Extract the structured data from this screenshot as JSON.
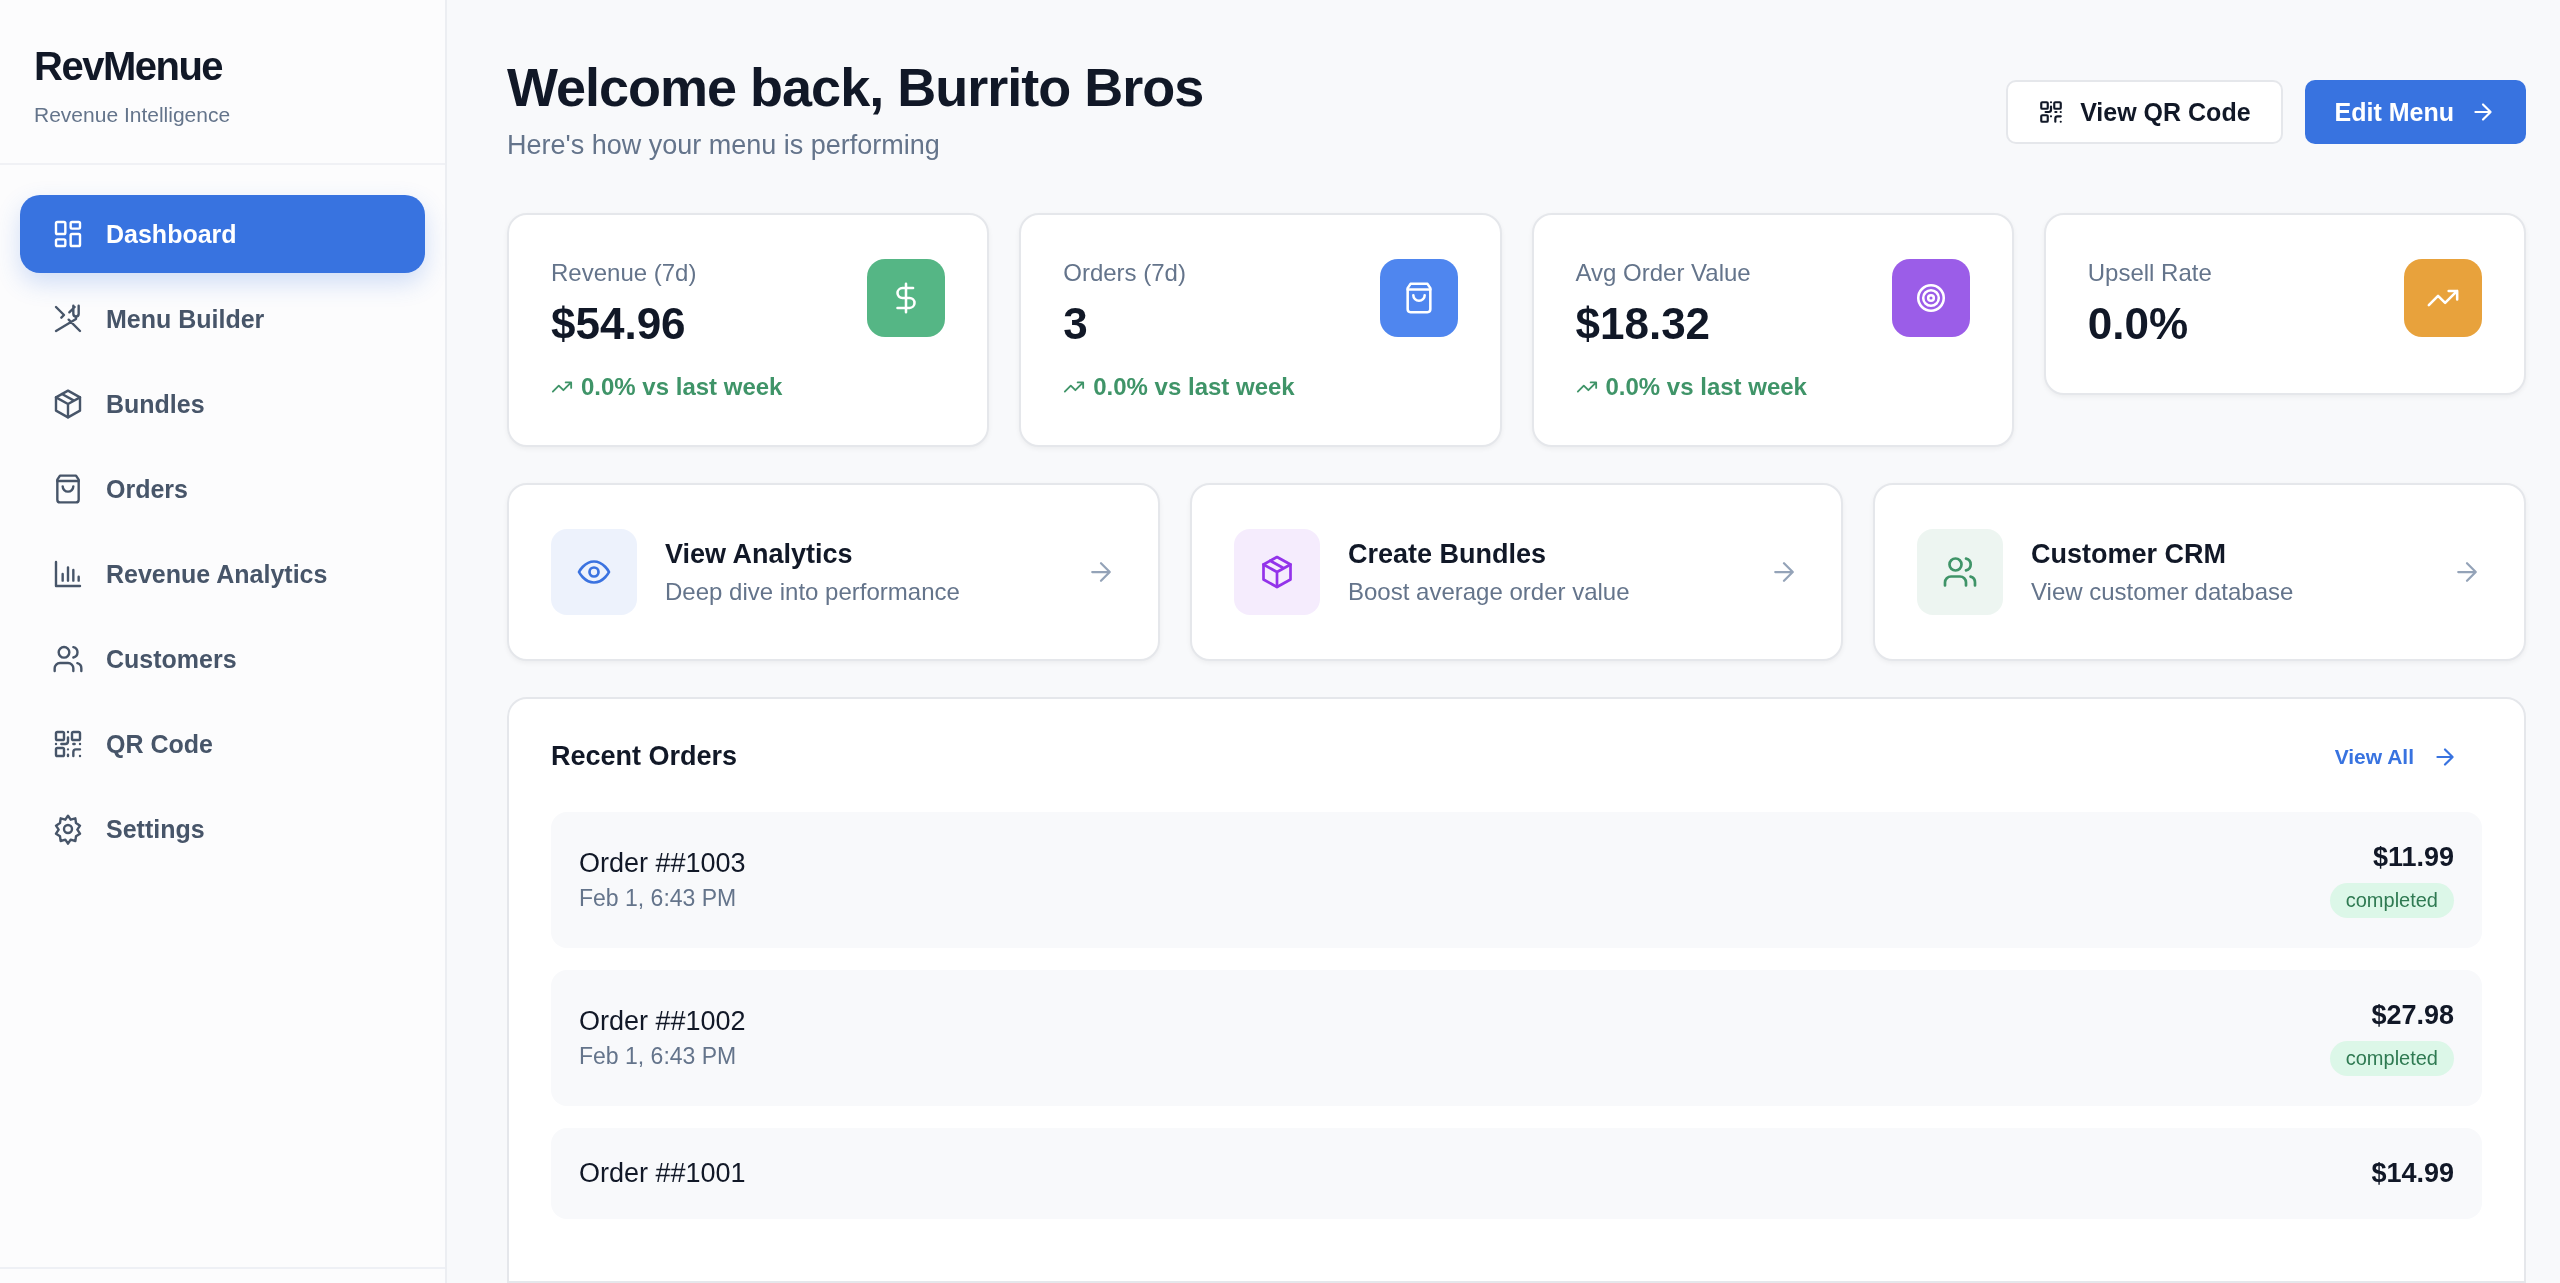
{
  "sidebar": {
    "logo": "RevMenue",
    "tagline": "Revenue Intelligence",
    "items": [
      {
        "label": "Dashboard",
        "selected": true
      },
      {
        "label": "Menu Builder",
        "selected": false
      },
      {
        "label": "Bundles",
        "selected": false
      },
      {
        "label": "Orders",
        "selected": false
      },
      {
        "label": "Revenue Analytics",
        "selected": false
      },
      {
        "label": "Customers",
        "selected": false
      },
      {
        "label": "QR Code",
        "selected": false
      },
      {
        "label": "Settings",
        "selected": false
      }
    ]
  },
  "header": {
    "title": "Welcome back, Burrito Bros",
    "subtitle": "Here's how your menu is performing",
    "buttons": [
      {
        "label": "View QR Code",
        "kind": "secondary"
      },
      {
        "label": "Edit Menu",
        "kind": "primary"
      }
    ]
  },
  "stats": [
    {
      "label": "Revenue (7d)",
      "value": "$54.96",
      "trend": "0.0% vs last week",
      "color": "#55b685"
    },
    {
      "label": "Orders (7d)",
      "value": "3",
      "trend": "0.0% vs last week",
      "color": "#4f86ef"
    },
    {
      "label": "Avg Order Value",
      "value": "$18.32",
      "trend": "0.0% vs last week",
      "color": "#9b5de8"
    },
    {
      "label": "Upsell Rate",
      "value": "0.0%",
      "color": "#e8a23c"
    }
  ],
  "actions": [
    {
      "title": "View Analytics",
      "description": "Deep dive into performance",
      "color": "#3b73e0"
    },
    {
      "title": "Create Bundles",
      "description": "Boost average order value",
      "color": "#9333ea"
    },
    {
      "title": "Customer CRM",
      "description": "View customer database",
      "color": "#3f9468"
    }
  ],
  "recent_orders": {
    "title": "Recent Orders",
    "link": "View All",
    "orders": [
      {
        "name": "Order ##1003",
        "time": "Feb 1, 6:43 PM",
        "total": "$11.99",
        "status": "completed"
      },
      {
        "name": "Order ##1002",
        "time": "Feb 1, 6:43 PM",
        "total": "$27.98",
        "status": "completed"
      },
      {
        "name": "Order ##1001",
        "total": "$14.99"
      }
    ]
  }
}
